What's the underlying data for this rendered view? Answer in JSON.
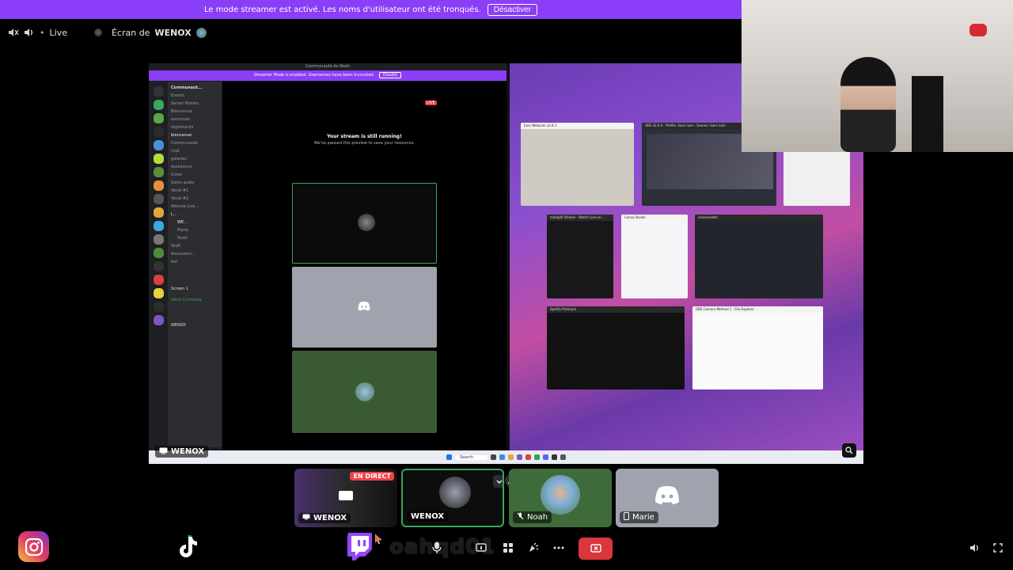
{
  "banner": {
    "text": "Le mode streamer est activé. Les noms d'utilisateur ont été tronqués.",
    "button": "Désactiver"
  },
  "status": {
    "live_label": "Live",
    "screen_prefix": "Écran de",
    "screen_owner": "WENOX"
  },
  "stream": {
    "window_title": "Communauté de Noah",
    "streamer_banner": "Streamer Mode is enabled. Usernames have been truncated.",
    "streamer_banner_button": "Disable",
    "live_badge": "LIVE",
    "running_title": "Your stream is still running!",
    "running_sub": "We've paused this preview to save your resources.",
    "server_name": "Communaut...",
    "channels": [
      "Events",
      "Server Boosts",
      "Bienvenue",
      "annonces",
      "règlements",
      "bienvenue",
      "Communauté",
      "chat",
      "galeries",
      "Assistance",
      "ticket",
      "Salon audio",
      "Vocal #1",
      "Vocal #2",
      "Attente Live...",
      "L...",
      "WE...",
      "Marie",
      "Noah",
      "Staff",
      "discussion...",
      "bot"
    ],
    "screen_label": "Screen 1",
    "voice_connected": "Voice Connecte",
    "user_tag": "WENOX",
    "windows": [
      {
        "title": "Iriun Webcam v2.8.1"
      },
      {
        "title": "OBS 32.0.4 - Profile: Sans nom - Scenes: Sans nom"
      },
      {
        "title": "mahqd0 Stream - Watch Live on..."
      },
      {
        "title": "Canva Studio"
      },
      {
        "title": "voicemeeter"
      },
      {
        "title": "Spotify Premium"
      },
      {
        "title": "OBS Camera Method 1 - File Explorer"
      }
    ],
    "taskbar_search": "Search"
  },
  "name_tag": "WENOX",
  "participants": [
    {
      "name": "WENOX",
      "badge": "EN DIRECT"
    },
    {
      "name": "WENOX"
    },
    {
      "name": "Noah"
    },
    {
      "name": "Marie"
    }
  ],
  "controls": {
    "username_overlay": "oahqd01"
  },
  "colors": {
    "accent": "#8b3ef7",
    "live": "#ed4245",
    "discord_blurple": "#5865f2",
    "speaking_green": "#3ba55c"
  }
}
